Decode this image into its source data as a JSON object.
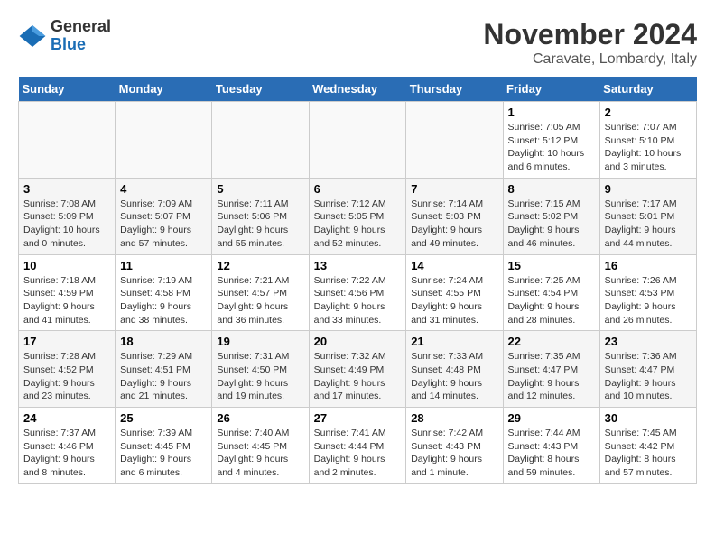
{
  "header": {
    "logo": {
      "line1": "General",
      "line2": "Blue"
    },
    "title": "November 2024",
    "location": "Caravate, Lombardy, Italy"
  },
  "weekdays": [
    "Sunday",
    "Monday",
    "Tuesday",
    "Wednesday",
    "Thursday",
    "Friday",
    "Saturday"
  ],
  "weeks": [
    [
      {
        "day": "",
        "info": ""
      },
      {
        "day": "",
        "info": ""
      },
      {
        "day": "",
        "info": ""
      },
      {
        "day": "",
        "info": ""
      },
      {
        "day": "",
        "info": ""
      },
      {
        "day": "1",
        "info": "Sunrise: 7:05 AM\nSunset: 5:12 PM\nDaylight: 10 hours\nand 6 minutes."
      },
      {
        "day": "2",
        "info": "Sunrise: 7:07 AM\nSunset: 5:10 PM\nDaylight: 10 hours\nand 3 minutes."
      }
    ],
    [
      {
        "day": "3",
        "info": "Sunrise: 7:08 AM\nSunset: 5:09 PM\nDaylight: 10 hours\nand 0 minutes."
      },
      {
        "day": "4",
        "info": "Sunrise: 7:09 AM\nSunset: 5:07 PM\nDaylight: 9 hours\nand 57 minutes."
      },
      {
        "day": "5",
        "info": "Sunrise: 7:11 AM\nSunset: 5:06 PM\nDaylight: 9 hours\nand 55 minutes."
      },
      {
        "day": "6",
        "info": "Sunrise: 7:12 AM\nSunset: 5:05 PM\nDaylight: 9 hours\nand 52 minutes."
      },
      {
        "day": "7",
        "info": "Sunrise: 7:14 AM\nSunset: 5:03 PM\nDaylight: 9 hours\nand 49 minutes."
      },
      {
        "day": "8",
        "info": "Sunrise: 7:15 AM\nSunset: 5:02 PM\nDaylight: 9 hours\nand 46 minutes."
      },
      {
        "day": "9",
        "info": "Sunrise: 7:17 AM\nSunset: 5:01 PM\nDaylight: 9 hours\nand 44 minutes."
      }
    ],
    [
      {
        "day": "10",
        "info": "Sunrise: 7:18 AM\nSunset: 4:59 PM\nDaylight: 9 hours\nand 41 minutes."
      },
      {
        "day": "11",
        "info": "Sunrise: 7:19 AM\nSunset: 4:58 PM\nDaylight: 9 hours\nand 38 minutes."
      },
      {
        "day": "12",
        "info": "Sunrise: 7:21 AM\nSunset: 4:57 PM\nDaylight: 9 hours\nand 36 minutes."
      },
      {
        "day": "13",
        "info": "Sunrise: 7:22 AM\nSunset: 4:56 PM\nDaylight: 9 hours\nand 33 minutes."
      },
      {
        "day": "14",
        "info": "Sunrise: 7:24 AM\nSunset: 4:55 PM\nDaylight: 9 hours\nand 31 minutes."
      },
      {
        "day": "15",
        "info": "Sunrise: 7:25 AM\nSunset: 4:54 PM\nDaylight: 9 hours\nand 28 minutes."
      },
      {
        "day": "16",
        "info": "Sunrise: 7:26 AM\nSunset: 4:53 PM\nDaylight: 9 hours\nand 26 minutes."
      }
    ],
    [
      {
        "day": "17",
        "info": "Sunrise: 7:28 AM\nSunset: 4:52 PM\nDaylight: 9 hours\nand 23 minutes."
      },
      {
        "day": "18",
        "info": "Sunrise: 7:29 AM\nSunset: 4:51 PM\nDaylight: 9 hours\nand 21 minutes."
      },
      {
        "day": "19",
        "info": "Sunrise: 7:31 AM\nSunset: 4:50 PM\nDaylight: 9 hours\nand 19 minutes."
      },
      {
        "day": "20",
        "info": "Sunrise: 7:32 AM\nSunset: 4:49 PM\nDaylight: 9 hours\nand 17 minutes."
      },
      {
        "day": "21",
        "info": "Sunrise: 7:33 AM\nSunset: 4:48 PM\nDaylight: 9 hours\nand 14 minutes."
      },
      {
        "day": "22",
        "info": "Sunrise: 7:35 AM\nSunset: 4:47 PM\nDaylight: 9 hours\nand 12 minutes."
      },
      {
        "day": "23",
        "info": "Sunrise: 7:36 AM\nSunset: 4:47 PM\nDaylight: 9 hours\nand 10 minutes."
      }
    ],
    [
      {
        "day": "24",
        "info": "Sunrise: 7:37 AM\nSunset: 4:46 PM\nDaylight: 9 hours\nand 8 minutes."
      },
      {
        "day": "25",
        "info": "Sunrise: 7:39 AM\nSunset: 4:45 PM\nDaylight: 9 hours\nand 6 minutes."
      },
      {
        "day": "26",
        "info": "Sunrise: 7:40 AM\nSunset: 4:45 PM\nDaylight: 9 hours\nand 4 minutes."
      },
      {
        "day": "27",
        "info": "Sunrise: 7:41 AM\nSunset: 4:44 PM\nDaylight: 9 hours\nand 2 minutes."
      },
      {
        "day": "28",
        "info": "Sunrise: 7:42 AM\nSunset: 4:43 PM\nDaylight: 9 hours\nand 1 minute."
      },
      {
        "day": "29",
        "info": "Sunrise: 7:44 AM\nSunset: 4:43 PM\nDaylight: 8 hours\nand 59 minutes."
      },
      {
        "day": "30",
        "info": "Sunrise: 7:45 AM\nSunset: 4:42 PM\nDaylight: 8 hours\nand 57 minutes."
      }
    ]
  ]
}
